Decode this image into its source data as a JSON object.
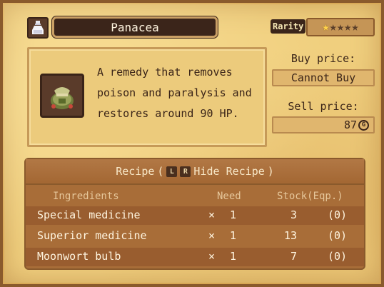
{
  "item": {
    "icon": "potion-bottle-icon",
    "name": "Panacea",
    "rarity_label": "Rarity",
    "rarity_stars": 1,
    "rarity_max": 5,
    "picture_icon": "medicine-pouch-icon",
    "description": "A remedy that removes\npoison and paralysis and\nrestores around 90 HP."
  },
  "price": {
    "buy_label": "Buy price:",
    "buy_value": "Cannot Buy",
    "sell_label": "Sell price:",
    "sell_value": "87",
    "currency_icon": "gold-coin-icon",
    "currency_glyph": "G"
  },
  "recipe": {
    "title": "Recipe",
    "key_l": "L",
    "key_r": "R",
    "hide_label": "Hide Recipe",
    "paren_open": "(",
    "paren_close": ")",
    "columns": {
      "ingredients": "Ingredients",
      "need": "Need",
      "stock": "Stock(Eqp.)"
    },
    "times_symbol": "×",
    "rows": [
      {
        "name": "Special medicine",
        "need": "1",
        "stock": "3",
        "eqp": "(0)"
      },
      {
        "name": "Superior medicine",
        "need": "1",
        "stock": "13",
        "eqp": "(0)"
      },
      {
        "name": "Moonwort bulb",
        "need": "1",
        "stock": "7",
        "eqp": "(0)"
      }
    ]
  },
  "colors": {
    "parchment": "#f0cf7e",
    "dark_brown": "#3b251a",
    "recipe_bg": "#a86d38",
    "star_filled": "#ffd24a"
  }
}
